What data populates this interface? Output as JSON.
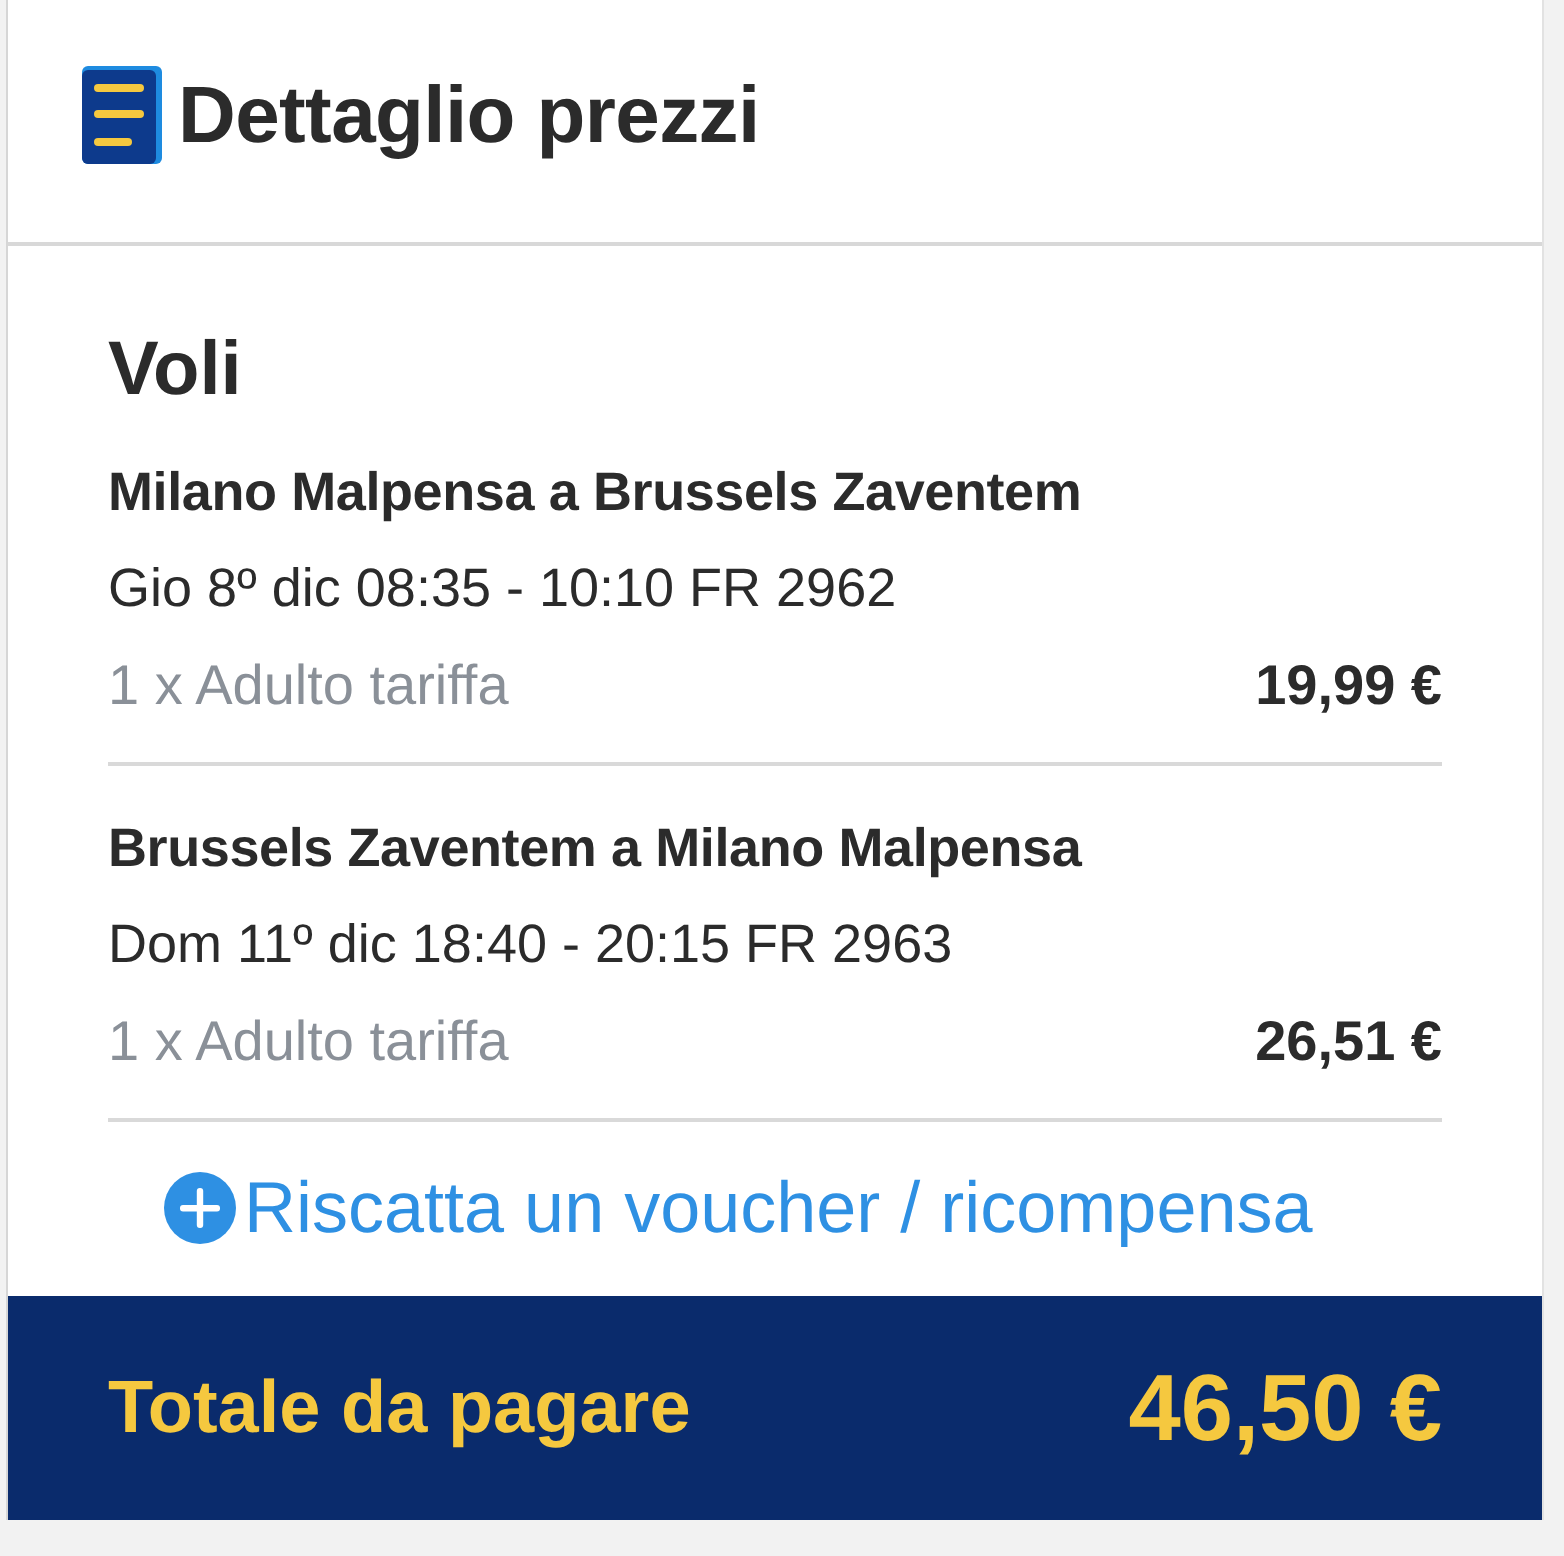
{
  "header": {
    "title": "Dettaglio prezzi"
  },
  "section": {
    "title": "Voli"
  },
  "flights": [
    {
      "route": "Milano Malpensa a Brussels Zaventem",
      "details": "Gio 8º dic 08:35 - 10:10 FR 2962",
      "fare_label": "1 x Adulto tariffa",
      "price": "19,99 €"
    },
    {
      "route": "Brussels Zaventem a Milano Malpensa",
      "details": "Dom 11º dic 18:40 - 20:15 FR 2963",
      "fare_label": "1 x Adulto tariffa",
      "price": "26,51 €"
    }
  ],
  "voucher_link": {
    "label": "Riscatta un voucher / ricompensa"
  },
  "total": {
    "label": "Totale da pagare",
    "amount": "46,50 €"
  }
}
